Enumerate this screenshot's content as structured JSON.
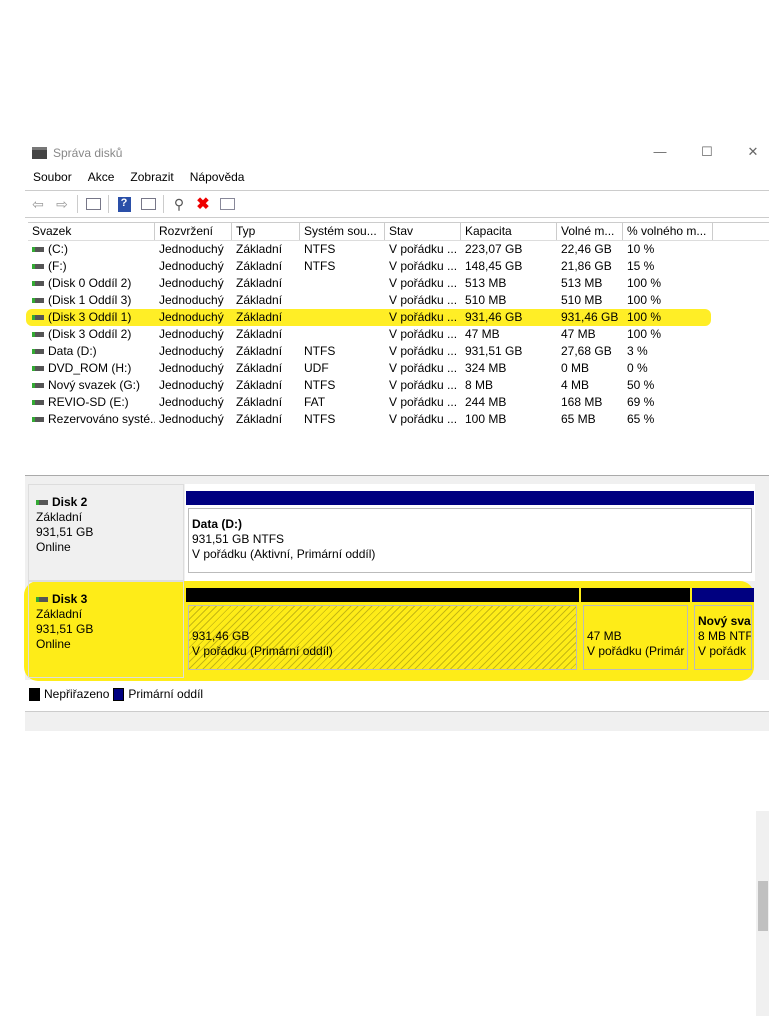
{
  "window": {
    "title": "Správa disků",
    "minimize": "—",
    "maximize": "☐",
    "close": "✕"
  },
  "menu": [
    "Soubor",
    "Akce",
    "Zobrazit",
    "Nápověda"
  ],
  "toolbar": {
    "icons": [
      "back-arrow-icon",
      "forward-arrow-icon",
      "console-tree-icon",
      "help-icon",
      "action-pane-icon",
      "connect-drive-icon",
      "delete-icon",
      "properties-icon"
    ]
  },
  "columns": [
    "Svazek",
    "Rozvržení",
    "Typ",
    "Systém sou...",
    "Stav",
    "Kapacita",
    "Volné m...",
    "% volného m..."
  ],
  "rows": [
    [
      "(C:)",
      "Jednoduchý",
      "Základní",
      "NTFS",
      "V pořádku ...",
      "223,07 GB",
      "22,46 GB",
      "10 %"
    ],
    [
      "(F:)",
      "Jednoduchý",
      "Základní",
      "NTFS",
      "V pořádku ...",
      "148,45 GB",
      "21,86 GB",
      "15 %"
    ],
    [
      "(Disk 0 Oddíl 2)",
      "Jednoduchý",
      "Základní",
      "",
      "V pořádku ...",
      "513 MB",
      "513 MB",
      "100 %"
    ],
    [
      "(Disk 1 Oddíl 3)",
      "Jednoduchý",
      "Základní",
      "",
      "V pořádku ...",
      "510 MB",
      "510 MB",
      "100 %"
    ],
    [
      "(Disk 3 Oddíl 1)",
      "Jednoduchý",
      "Základní",
      "",
      "V pořádku ...",
      "931,46 GB",
      "931,46 GB",
      "100 %"
    ],
    [
      "(Disk 3 Oddíl 2)",
      "Jednoduchý",
      "Základní",
      "",
      "V pořádku ...",
      "47 MB",
      "47 MB",
      "100 %"
    ],
    [
      "Data (D:)",
      "Jednoduchý",
      "Základní",
      "NTFS",
      "V pořádku ...",
      "931,51 GB",
      "27,68 GB",
      "3 %"
    ],
    [
      "DVD_ROM (H:)",
      "Jednoduchý",
      "Základní",
      "UDF",
      "V pořádku ...",
      "324 MB",
      "0 MB",
      "0 %"
    ],
    [
      "Nový svazek (G:)",
      "Jednoduchý",
      "Základní",
      "NTFS",
      "V pořádku ...",
      "8 MB",
      "4 MB",
      "50 %"
    ],
    [
      "REVIO-SD (E:)",
      "Jednoduchý",
      "Základní",
      "FAT",
      "V pořádku ...",
      "244 MB",
      "168 MB",
      "69 %"
    ],
    [
      "Rezervováno systé...",
      "Jednoduchý",
      "Základní",
      "NTFS",
      "V pořádku ...",
      "100 MB",
      "65 MB",
      "65 %"
    ]
  ],
  "highlighted_row": 4,
  "disks": [
    {
      "name": "Disk 2",
      "type": "Základní",
      "size": "931,51 GB",
      "status": "Online",
      "partitions": [
        {
          "title": "Data  (D:)",
          "line1": "931,51 GB NTFS",
          "line2": "V pořádku (Aktivní, Primární oddíl)",
          "kind": "primary"
        }
      ]
    },
    {
      "name": "Disk 3",
      "type": "Základní",
      "size": "931,51 GB",
      "status": "Online",
      "partitions": [
        {
          "title": "",
          "line1": "931,46 GB",
          "line2": "V pořádku (Primární oddíl)",
          "kind": "unallocated"
        },
        {
          "title": "",
          "line1": "47 MB",
          "line2": "V pořádku (Primár",
          "kind": "unallocated"
        },
        {
          "title": "Nový sva",
          "line1": "8 MB NTF",
          "line2": "V pořádk",
          "kind": "primary"
        }
      ]
    }
  ],
  "legend": [
    {
      "label": "Nepřiřazeno",
      "color": "#000000"
    },
    {
      "label": "Primární oddíl",
      "color": "#000080"
    }
  ],
  "colors": {
    "primary": "#000080",
    "unallocated": "#000000",
    "highlight": "#ffeb00"
  }
}
